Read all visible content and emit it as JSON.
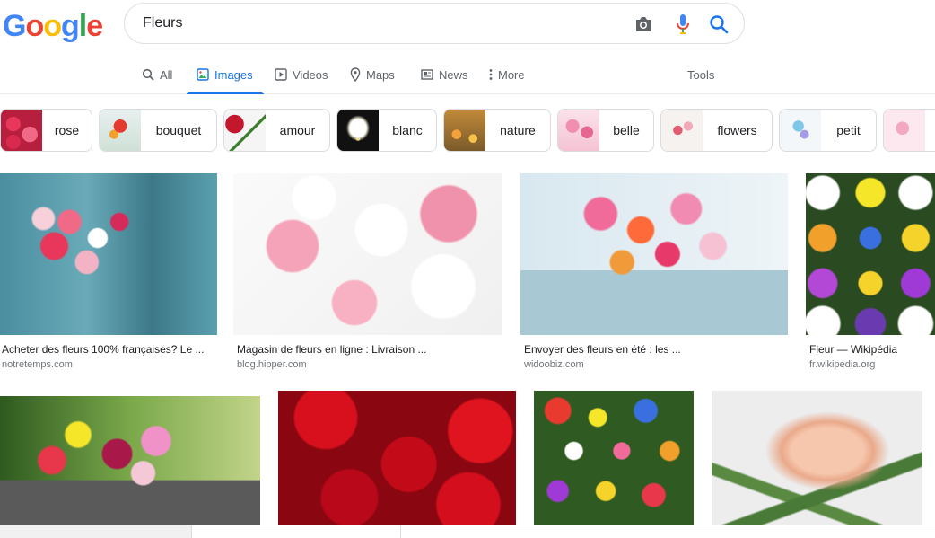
{
  "logo": {
    "letters": [
      "G",
      "o",
      "o",
      "g",
      "l",
      "e"
    ],
    "colors": [
      "#4285f4",
      "#ea4335",
      "#fbbc05",
      "#4285f4",
      "#34a853",
      "#ea4335"
    ]
  },
  "search": {
    "query": "Fleurs",
    "camera_icon": "camera-icon",
    "mic_icon": "microphone-icon",
    "search_icon": "search-icon"
  },
  "tabs": [
    {
      "label": "All",
      "icon": "search-icon"
    },
    {
      "label": "Images",
      "icon": "image-icon",
      "active": true
    },
    {
      "label": "Videos",
      "icon": "play-icon"
    },
    {
      "label": "Maps",
      "icon": "map-pin-icon"
    },
    {
      "label": "News",
      "icon": "newspaper-icon"
    },
    {
      "label": "More",
      "icon": "more-vertical-icon"
    }
  ],
  "tools_label": "Tools",
  "chips": [
    {
      "label": "rose"
    },
    {
      "label": "bouquet"
    },
    {
      "label": "amour"
    },
    {
      "label": "blanc"
    },
    {
      "label": "nature"
    },
    {
      "label": "belle"
    },
    {
      "label": "flowers"
    },
    {
      "label": "petit"
    },
    {
      "label": ""
    }
  ],
  "results": [
    {
      "title": "Acheter des fleurs 100% françaises? Le ...",
      "source": "notretemps.com"
    },
    {
      "title": "Magasin de fleurs en ligne : Livraison ...",
      "source": "blog.hipper.com"
    },
    {
      "title": "Envoyer des fleurs en été : les ...",
      "source": "widoobiz.com"
    },
    {
      "title": "Fleur — Wikipédia",
      "source": "fr.wikipedia.org"
    },
    {
      "title": "",
      "source": ""
    },
    {
      "title": "",
      "source": ""
    },
    {
      "title": "",
      "source": ""
    },
    {
      "title": "",
      "source": ""
    }
  ],
  "colors": {
    "accent": "#1a73e8",
    "text": "#202124",
    "muted": "#5f6368",
    "source": "#70757a"
  }
}
